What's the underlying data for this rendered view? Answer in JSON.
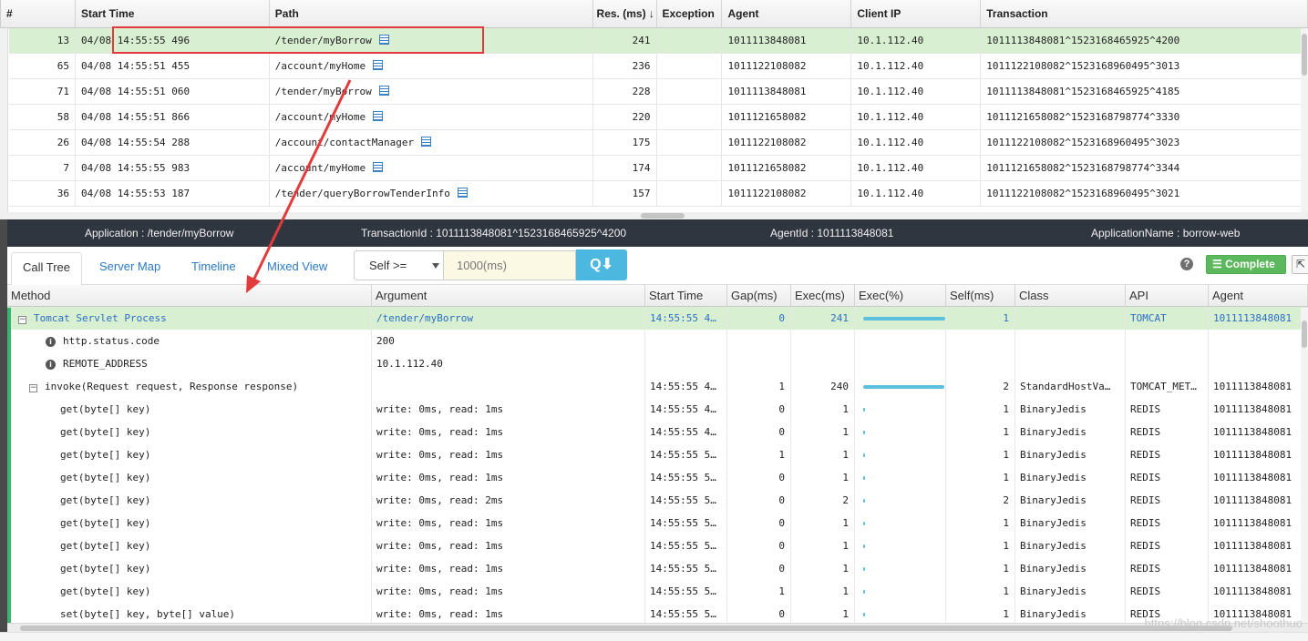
{
  "transactions": {
    "headers": [
      "#",
      "Start Time",
      "Path",
      "Res. (ms)",
      "Exception",
      "Agent",
      "Client IP",
      "Transaction"
    ],
    "sort_arrow": "↓",
    "rows": [
      {
        "n": "13",
        "start": "04/08 14:55:55 496",
        "path": "/tender/myBorrow",
        "res": "241",
        "exc": "",
        "agent": "1011113848081",
        "ip": "10.1.112.40",
        "txn": "1011113848081^1523168465925^4200"
      },
      {
        "n": "65",
        "start": "04/08 14:55:51 455",
        "path": "/account/myHome",
        "res": "236",
        "exc": "",
        "agent": "1011122108082",
        "ip": "10.1.112.40",
        "txn": "1011122108082^1523168960495^3013"
      },
      {
        "n": "71",
        "start": "04/08 14:55:51 060",
        "path": "/tender/myBorrow",
        "res": "228",
        "exc": "",
        "agent": "1011113848081",
        "ip": "10.1.112.40",
        "txn": "1011113848081^1523168465925^4185"
      },
      {
        "n": "58",
        "start": "04/08 14:55:51 866",
        "path": "/account/myHome",
        "res": "220",
        "exc": "",
        "agent": "1011121658082",
        "ip": "10.1.112.40",
        "txn": "1011121658082^1523168798774^3330"
      },
      {
        "n": "26",
        "start": "04/08 14:55:54 288",
        "path": "/account/contactManager",
        "res": "175",
        "exc": "",
        "agent": "1011122108082",
        "ip": "10.1.112.40",
        "txn": "1011122108082^1523168960495^3023"
      },
      {
        "n": "7",
        "start": "04/08 14:55:55 983",
        "path": "/account/myHome",
        "res": "174",
        "exc": "",
        "agent": "1011121658082",
        "ip": "10.1.112.40",
        "txn": "1011121658082^1523168798774^3344"
      },
      {
        "n": "36",
        "start": "04/08 14:55:53 187",
        "path": "/tender/queryBorrowTenderInfo",
        "res": "157",
        "exc": "",
        "agent": "1011122108082",
        "ip": "10.1.112.40",
        "txn": "1011122108082^1523168960495^3021"
      }
    ]
  },
  "info_bar": {
    "application": "Application : /tender/myBorrow",
    "transaction_id": "TransactionId : 1011113848081^1523168465925^4200",
    "agent_id": "AgentId : 1011113848081",
    "application_name": "ApplicationName : borrow-web"
  },
  "toolbar": {
    "tabs": [
      "Call Tree",
      "Server Map",
      "Timeline",
      "Mixed View"
    ],
    "self_filter": "Self >=",
    "ms_placeholder": "1000(ms)",
    "search_glyph": "Q⬇",
    "help_glyph": "?",
    "complete_label": "☰ Complete",
    "export_glyph": "⇱"
  },
  "call_tree": {
    "headers": [
      "Method",
      "Argument",
      "Start Time",
      "Gap(ms)",
      "Exec(ms)",
      "Exec(%)",
      "Self(ms)",
      "Class",
      "API",
      "Agent"
    ],
    "rows": [
      {
        "kind": "root",
        "method": "Tomcat Servlet Process",
        "arg": "/tender/myBorrow",
        "start": "14:55:55 4…",
        "gap": "0",
        "exec": "241",
        "pct": 100,
        "self": "1",
        "cls": "",
        "api": "TOMCAT",
        "agent": "1011113848081"
      },
      {
        "kind": "info",
        "method": "http.status.code",
        "arg": "200",
        "start": "",
        "gap": "",
        "exec": "",
        "pct": 0,
        "self": "",
        "cls": "",
        "api": "",
        "agent": ""
      },
      {
        "kind": "info",
        "method": "REMOTE_ADDRESS",
        "arg": "10.1.112.40",
        "start": "",
        "gap": "",
        "exec": "",
        "pct": 0,
        "self": "",
        "cls": "",
        "api": "",
        "agent": ""
      },
      {
        "kind": "group",
        "method": "invoke(Request request, Response response)",
        "arg": "",
        "start": "14:55:55 4…",
        "gap": "1",
        "exec": "240",
        "pct": 99,
        "self": "2",
        "cls": "StandardHostVa…",
        "api": "TOMCAT_MET…",
        "agent": "1011113848081"
      },
      {
        "kind": "leaf",
        "method": "get(byte[] key)",
        "arg": "write: 0ms, read: 1ms",
        "start": "14:55:55 4…",
        "gap": "0",
        "exec": "1",
        "pct": 1,
        "self": "1",
        "cls": "BinaryJedis",
        "api": "REDIS",
        "agent": "1011113848081"
      },
      {
        "kind": "leaf",
        "method": "get(byte[] key)",
        "arg": "write: 0ms, read: 1ms",
        "start": "14:55:55 4…",
        "gap": "0",
        "exec": "1",
        "pct": 1,
        "self": "1",
        "cls": "BinaryJedis",
        "api": "REDIS",
        "agent": "1011113848081"
      },
      {
        "kind": "leaf",
        "method": "get(byte[] key)",
        "arg": "write: 0ms, read: 1ms",
        "start": "14:55:55 5…",
        "gap": "1",
        "exec": "1",
        "pct": 1,
        "self": "1",
        "cls": "BinaryJedis",
        "api": "REDIS",
        "agent": "1011113848081"
      },
      {
        "kind": "leaf",
        "method": "get(byte[] key)",
        "arg": "write: 0ms, read: 1ms",
        "start": "14:55:55 5…",
        "gap": "0",
        "exec": "1",
        "pct": 1,
        "self": "1",
        "cls": "BinaryJedis",
        "api": "REDIS",
        "agent": "1011113848081"
      },
      {
        "kind": "leaf",
        "method": "get(byte[] key)",
        "arg": "write: 0ms, read: 2ms",
        "start": "14:55:55 5…",
        "gap": "0",
        "exec": "2",
        "pct": 1,
        "self": "2",
        "cls": "BinaryJedis",
        "api": "REDIS",
        "agent": "1011113848081"
      },
      {
        "kind": "leaf",
        "method": "get(byte[] key)",
        "arg": "write: 0ms, read: 1ms",
        "start": "14:55:55 5…",
        "gap": "0",
        "exec": "1",
        "pct": 1,
        "self": "1",
        "cls": "BinaryJedis",
        "api": "REDIS",
        "agent": "1011113848081"
      },
      {
        "kind": "leaf",
        "method": "get(byte[] key)",
        "arg": "write: 0ms, read: 1ms",
        "start": "14:55:55 5…",
        "gap": "0",
        "exec": "1",
        "pct": 1,
        "self": "1",
        "cls": "BinaryJedis",
        "api": "REDIS",
        "agent": "1011113848081"
      },
      {
        "kind": "leaf",
        "method": "get(byte[] key)",
        "arg": "write: 0ms, read: 1ms",
        "start": "14:55:55 5…",
        "gap": "0",
        "exec": "1",
        "pct": 1,
        "self": "1",
        "cls": "BinaryJedis",
        "api": "REDIS",
        "agent": "1011113848081"
      },
      {
        "kind": "leaf",
        "method": "get(byte[] key)",
        "arg": "write: 0ms, read: 1ms",
        "start": "14:55:55 5…",
        "gap": "1",
        "exec": "1",
        "pct": 1,
        "self": "1",
        "cls": "BinaryJedis",
        "api": "REDIS",
        "agent": "1011113848081"
      },
      {
        "kind": "leaf",
        "method": "set(byte[] key, byte[] value)",
        "arg": "write: 0ms, read: 1ms",
        "start": "14:55:55 5…",
        "gap": "0",
        "exec": "1",
        "pct": 1,
        "self": "1",
        "cls": "BinaryJedis",
        "api": "REDIS",
        "agent": "1011113848081"
      }
    ]
  },
  "watermark": "https://blog.csdn.net/shoothuo",
  "colors": {
    "selected_row": "#d9efd2",
    "annotation": "#e23b3b",
    "bar": "#5bc0de",
    "complete": "#5cb85c"
  }
}
